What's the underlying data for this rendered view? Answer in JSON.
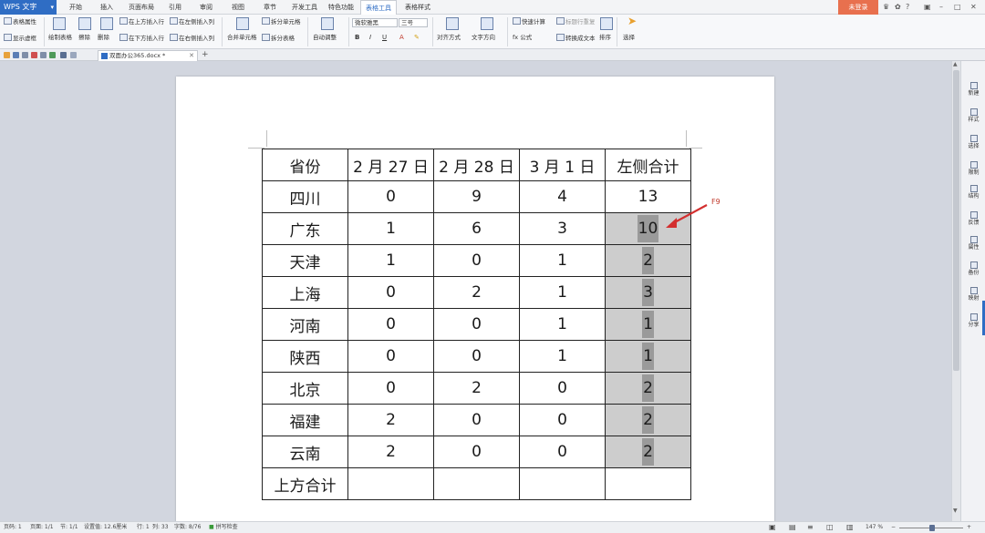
{
  "app": {
    "name": "WPS 文字",
    "document_tab": "双面办公365.docx *",
    "login_button": "未登录"
  },
  "menu": {
    "items": [
      "开始",
      "插入",
      "页面布局",
      "引用",
      "审阅",
      "视图",
      "章节",
      "开发工具",
      "特色功能",
      "表格工具",
      "表格样式"
    ],
    "active": "表格工具"
  },
  "ribbon": {
    "table_props": "表格属性",
    "show_gridlines": "显示虚框",
    "draw_table": "绘制表格",
    "erase": "擦除",
    "delete": "删除",
    "insert_above": "在上方插入行",
    "insert_below": "在下方插入行",
    "insert_left": "在左侧插入列",
    "insert_right": "在右侧插入列",
    "merge_cells": "合并单元格",
    "split_cells": "拆分单元格",
    "split_table": "拆分表格",
    "autofit": "自动调整",
    "font_name": "微软雅黑",
    "font_size": "三号",
    "align": "对齐方式",
    "text_direction": "文字方向",
    "quick_calc": "快速计算",
    "header_repeat": "标题行重复",
    "formula": "fx 公式",
    "to_text": "转换成文本",
    "sort": "排序",
    "select": "选择"
  },
  "table": {
    "header": [
      "省份",
      "2 月 27 日",
      "2 月 28 日",
      "3 月 1 日",
      "左侧合计"
    ],
    "rows": [
      [
        "四川",
        "0",
        "9",
        "4",
        "13"
      ],
      [
        "广东",
        "1",
        "6",
        "3",
        "10"
      ],
      [
        "天津",
        "1",
        "0",
        "1",
        "2"
      ],
      [
        "上海",
        "0",
        "2",
        "1",
        "3"
      ],
      [
        "河南",
        "0",
        "0",
        "1",
        "1"
      ],
      [
        "陕西",
        "0",
        "0",
        "1",
        "1"
      ],
      [
        "北京",
        "0",
        "2",
        "0",
        "2"
      ],
      [
        "福建",
        "2",
        "0",
        "0",
        "2"
      ],
      [
        "云南",
        "2",
        "0",
        "0",
        "2"
      ]
    ],
    "footer": [
      "上方合计",
      "",
      "",
      "",
      ""
    ]
  },
  "annotation": {
    "label": "F9",
    "color": "#d32f2f"
  },
  "right_panel": [
    "新建",
    "样式",
    "选择",
    "限制",
    "结构",
    "反馈",
    "属性",
    "备份",
    "映射",
    "分享"
  ],
  "status_bar": {
    "page_num": "页码: 1",
    "pages": "页面: 1/1",
    "section": "节: 1/1",
    "set_value": "设置值: 12.6厘米",
    "row": "行: 1",
    "col": "列: 33",
    "words": "字数: 8/76",
    "spell": "拼写检查",
    "zoom": "147 %"
  }
}
